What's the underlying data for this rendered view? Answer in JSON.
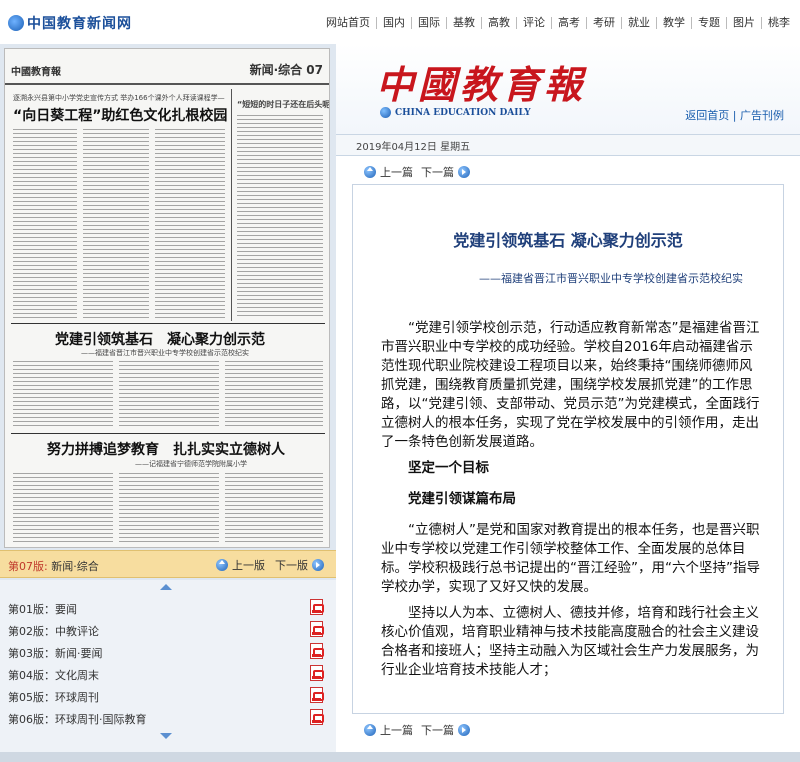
{
  "site": {
    "logo_text": "中国教育新闻网",
    "nav": [
      "网站首页",
      "国内",
      "国际",
      "基教",
      "高教",
      "评论",
      "高考",
      "考研",
      "就业",
      "教学",
      "专题",
      "图片",
      "桃李"
    ]
  },
  "thumbnail": {
    "masthead": "中國教育報",
    "section": "新闻·综合 07",
    "headline_1_kicker": "逐溯永兴县第中小学党史宣传方式 举办166个课外个人拜读课程学—",
    "headline_1": "“向日葵工程”助红色文化扎根校园",
    "headline_2_kicker": "“短短的时日子还在后头呢”",
    "headline_3": "党建引领筑基石　凝心聚力创示范",
    "headline_3_sub": "——福建省晋江市晋兴职业中专学校创建省示范校纪实",
    "headline_4": "努力拼搏追梦教育　扎扎实实立德树人",
    "headline_4_sub": "——记福建省宁德师范学院附属小学"
  },
  "issue_bar": {
    "current_label": "第07版:",
    "current_name": "新闻·综合",
    "prev": "上一版",
    "next": "下一版"
  },
  "pages": [
    {
      "label": "第01版：要闻"
    },
    {
      "label": "第02版：中教评论"
    },
    {
      "label": "第03版：新闻·要闻"
    },
    {
      "label": "第04版：文化周末"
    },
    {
      "label": "第05版：环球周刊"
    },
    {
      "label": "第06版：环球周刊·国际教育"
    }
  ],
  "paper": {
    "logo": "中國教育報",
    "logo_en": "CHINA EDUCATION DAILY",
    "links": "返回首页 | 广告刊例",
    "date": "2019年04月12日 星期五"
  },
  "pager": {
    "prev": "上一篇",
    "next": "下一篇"
  },
  "article": {
    "title": "党建引领筑基石 凝心聚力创示范",
    "subtitle": "——福建省晋江市晋兴职业中专学校创建省示范校纪实",
    "p1": "“党建引领学校创示范，行动适应教育新常态”是福建省晋江市晋兴职业中专学校的成功经验。学校自2016年启动福建省示范性现代职业院校建设工程项目以来，始终秉持“围绕师德师风抓党建，围绕教育质量抓党建，围绕学校发展抓党建”的工作思路，以“党建引领、支部带动、党员示范”为党建模式，全面践行立德树人的根本任务，实现了党在学校发展中的引领作用，走出了一条特色创新发展道路。",
    "h1": "坚定一个目标",
    "h2": "党建引领谋篇布局",
    "p2": "“立德树人”是党和国家对教育提出的根本任务，也是晋兴职业中专学校以党建工作引领学校整体工作、全面发展的总体目标。学校积极践行总书记提出的“晋江经验”，用“六个坚持”指导学校办学，实现了又好又快的发展。",
    "p3": "坚持以人为本、立德树人、德技并修，培育和践行社会主义核心价值观，培育职业精神与技术技能高度融合的社会主义建设合格者和接班人；坚持主动融入为区域社会生产力发展服务，为行业企业培育技术技能人才；"
  }
}
